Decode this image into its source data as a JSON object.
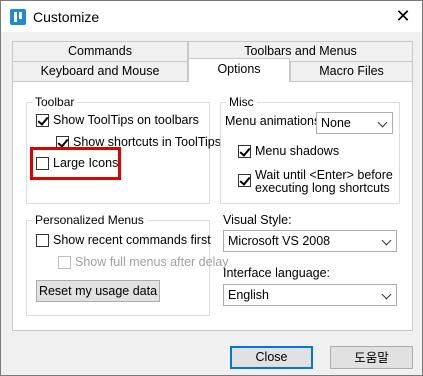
{
  "window": {
    "title": "Customize",
    "close_glyph": "✕"
  },
  "tabs": {
    "row1": [
      "Commands",
      "Toolbars and Menus"
    ],
    "row2": [
      "Keyboard and Mouse",
      "Options",
      "Macro Files"
    ]
  },
  "toolbar_group": {
    "label": "Toolbar",
    "show_tooltips": "Show ToolTips on toolbars",
    "show_shortcuts": "Show shortcuts in ToolTips",
    "large_icons": "Large Icons"
  },
  "personalized_group": {
    "label": "Personalized Menus",
    "show_recent": "Show recent commands first",
    "show_full_after_delay": "Show full menus after delay",
    "reset_button": "Reset my usage data"
  },
  "misc_group": {
    "label": "Misc",
    "menu_animations_label": "Menu animations:",
    "menu_animations_value": "None",
    "menu_shadows": "Menu shadows",
    "wait_enter_line1": "Wait until <Enter> before",
    "wait_enter_line2": "executing long shortcuts"
  },
  "visual_style": {
    "label": "Visual Style:",
    "value": "Microsoft VS 2008"
  },
  "interface_language": {
    "label": "Interface language:",
    "value": "English"
  },
  "buttons": {
    "close": "Close",
    "help": "도움말"
  },
  "state": {
    "show_tooltips": true,
    "show_shortcuts": true,
    "large_icons": false,
    "show_recent": false,
    "show_full_after_delay": false,
    "menu_shadows": true,
    "wait_enter": true
  },
  "colors": {
    "highlight": "#e00000",
    "primary_button_border": "#0078d7"
  }
}
